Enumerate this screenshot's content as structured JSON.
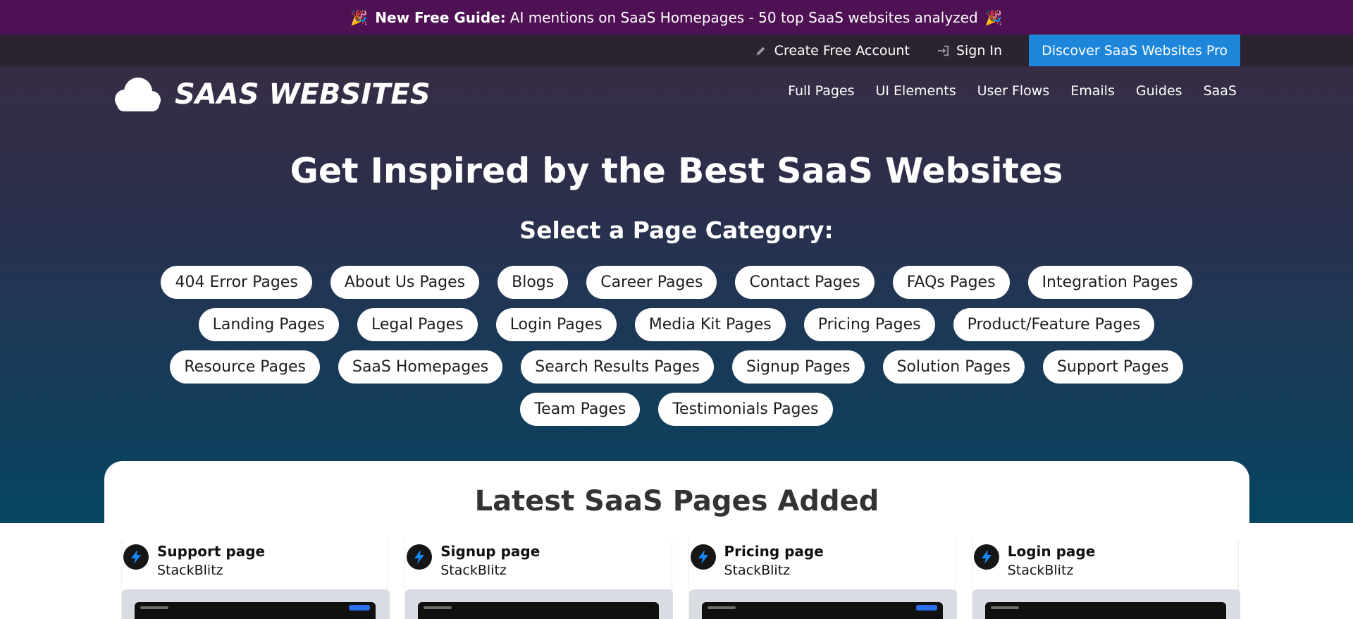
{
  "announcement": {
    "emoji": "🎉",
    "bold": "New Free Guide:",
    "text": "AI mentions on SaaS Homepages - 50 top SaaS websites analyzed"
  },
  "utility": {
    "create_account": "Create Free Account",
    "sign_in": "Sign In",
    "pro_button": "Discover SaaS Websites Pro"
  },
  "brand": {
    "logo_text": "SAAS WEBSITES"
  },
  "nav": [
    "Full Pages",
    "UI Elements",
    "User Flows",
    "Emails",
    "Guides",
    "SaaS"
  ],
  "hero": {
    "title": "Get Inspired by the Best SaaS Websites",
    "subtitle": "Select a Page Category:"
  },
  "categories": [
    "404 Error Pages",
    "About Us Pages",
    "Blogs",
    "Career Pages",
    "Contact Pages",
    "FAQs Pages",
    "Integration Pages",
    "Landing Pages",
    "Legal Pages",
    "Login Pages",
    "Media Kit Pages",
    "Pricing Pages",
    "Product/Feature Pages",
    "Resource Pages",
    "SaaS Homepages",
    "Search Results Pages",
    "Signup Pages",
    "Solution Pages",
    "Support Pages",
    "Team Pages",
    "Testimonials Pages"
  ],
  "latest": {
    "title": "Latest SaaS Pages Added",
    "cards": [
      {
        "type": "Support page",
        "brand": "StackBlitz"
      },
      {
        "type": "Signup page",
        "brand": "StackBlitz"
      },
      {
        "type": "Pricing page",
        "brand": "StackBlitz"
      },
      {
        "type": "Login page",
        "brand": "StackBlitz"
      }
    ]
  },
  "colors": {
    "announcement_bg": "#4e1154",
    "utility_bg": "#2b2430",
    "pro_button": "#1d86db",
    "stackblitz_bolt": "#1389fd"
  }
}
